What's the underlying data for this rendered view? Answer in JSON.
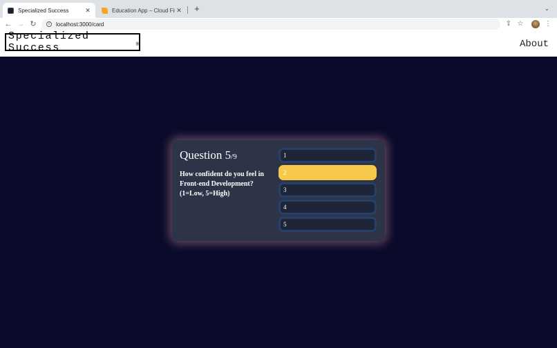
{
  "browser": {
    "tabs": [
      {
        "title": "Specialized Success",
        "active": true
      },
      {
        "title": "Education App – Cloud Firesto",
        "active": false
      }
    ],
    "url": "localhost:3000/card"
  },
  "site": {
    "logo": "Specialized Success",
    "logo_mark": "®",
    "nav_about": "About"
  },
  "quiz": {
    "question_label": "Question 5",
    "question_total": "/9",
    "question_text": "How confident do you feel in Front-end Development? (1=Low, 5=High)",
    "options": [
      "1",
      "2",
      "3",
      "4",
      "5"
    ],
    "selected_option": "2"
  },
  "colors": {
    "page_bg": "#0a0a2a",
    "card_bg": "#2d3448",
    "option_bg": "#1e2538",
    "option_border": "#26406a",
    "selected_option": "#f6c94a",
    "card_glow": "#d696a5"
  }
}
